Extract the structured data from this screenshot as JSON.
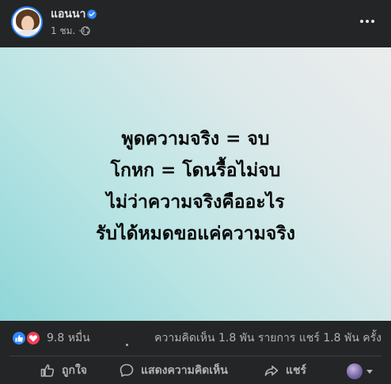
{
  "post": {
    "author": "แอนนา",
    "time": "1 ชม. ·",
    "image_text": [
      "พูดความจริง = จบ",
      "โกหก = โดนรื้อไม่จบ",
      "ไม่ว่าความจริงคืออะไร",
      "รับได้หมดขอแค่ความจริง"
    ],
    "reactions_count": "9.8 หมื่น",
    "stats_right": "ความคิดเห็น 1.8 พัน รายการ  แชร์ 1.8 พัน ครั้ง",
    "actions": {
      "like": "ถูกใจ",
      "comment": "แสดงความคิดเห็น",
      "share": "แชร์"
    }
  },
  "colors": {
    "background": "#242526",
    "text_primary": "#e4e6eb",
    "text_secondary": "#b0b3b8",
    "like_blue": "#2d88ff",
    "love_red": "#f33e58"
  },
  "icons": [
    "verified-badge-icon",
    "globe-icon",
    "more-options-icon",
    "like-reaction-icon",
    "love-reaction-icon",
    "thumbs-up-icon",
    "comment-icon",
    "share-icon",
    "chevron-down-icon"
  ]
}
